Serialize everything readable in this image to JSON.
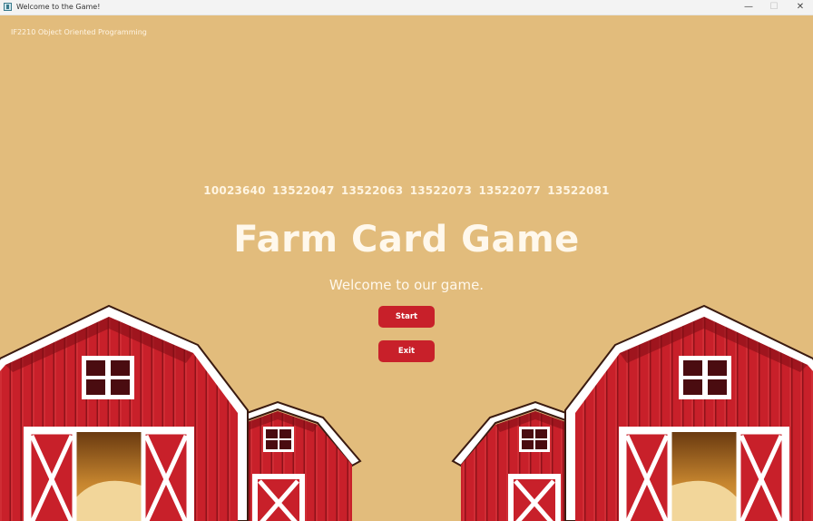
{
  "window": {
    "title": "Welcome to the Game!",
    "minimize_glyph": "—",
    "maximize_glyph": "☐",
    "close_glyph": "✕"
  },
  "course": "IF2210 Object Oriented Programming",
  "student_ids": [
    "10023640",
    "13522047",
    "13522063",
    "13522073",
    "13522077",
    "13522081"
  ],
  "game_title": "Farm Card Game",
  "welcome_text": "Welcome to our game.",
  "buttons": {
    "start": "Start",
    "exit": "Exit"
  },
  "colors": {
    "background": "#e2bc7c",
    "button": "#c8202a",
    "barn_red": "#c8202a",
    "barn_dark": "#5a0e14",
    "hay": "#c7862f"
  },
  "icons": [
    "app-icon",
    "minimize-icon",
    "maximize-icon",
    "close-icon",
    "barn-illustration"
  ]
}
